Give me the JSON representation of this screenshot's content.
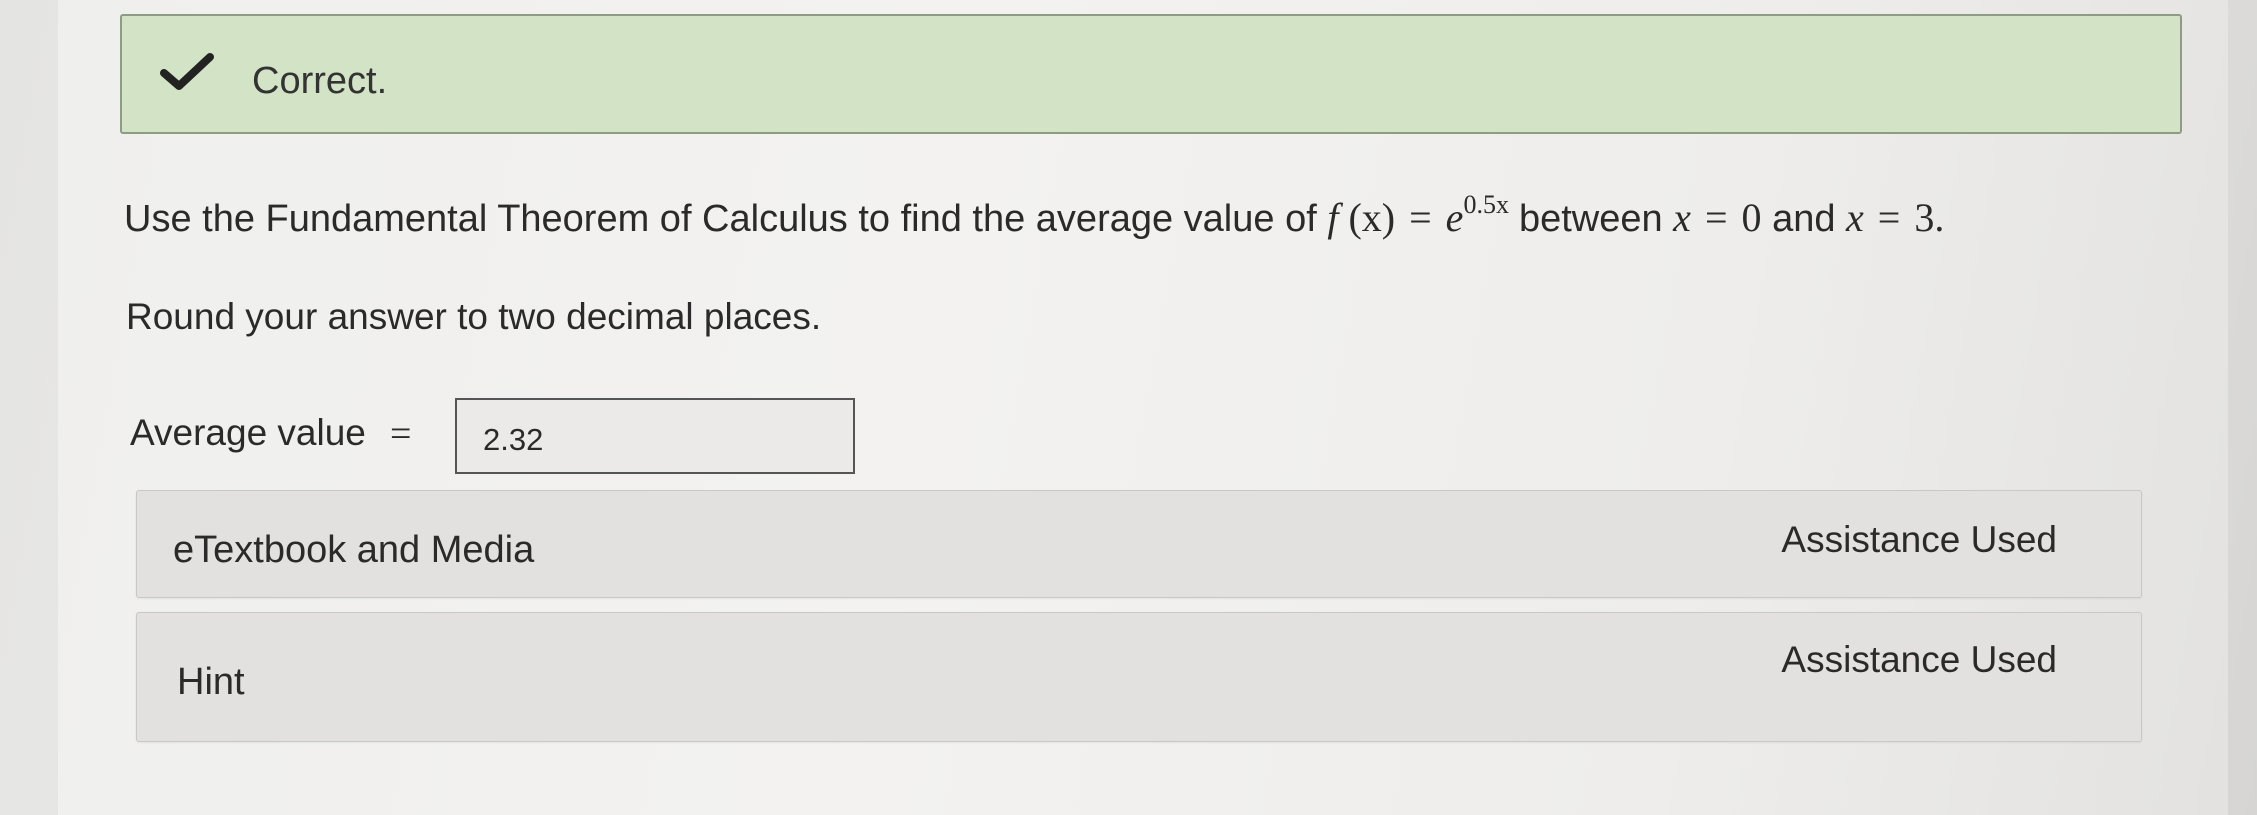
{
  "feedback": {
    "icon": "checkmark-icon",
    "text": "Correct.",
    "background_color": "#d3e3c6",
    "border_color": "#8e9c86"
  },
  "question": {
    "intro": "Use the Fundamental Theorem of Calculus to find the average value of",
    "function_name": "f",
    "function_arg": "(x)",
    "equals": "=",
    "base": "e",
    "exponent": "0.5x",
    "between": "between",
    "var1": "x",
    "value1": "0",
    "and": "and",
    "var2": "x",
    "value2": "3",
    "period": "."
  },
  "instruction": "Round your answer to two decimal places.",
  "answer": {
    "label": "Average value",
    "equals": "=",
    "value": "2.32"
  },
  "resources": [
    {
      "title": "eTextbook and Media",
      "status": "Assistance Used"
    },
    {
      "title": "Hint",
      "status": "Assistance Used"
    }
  ]
}
